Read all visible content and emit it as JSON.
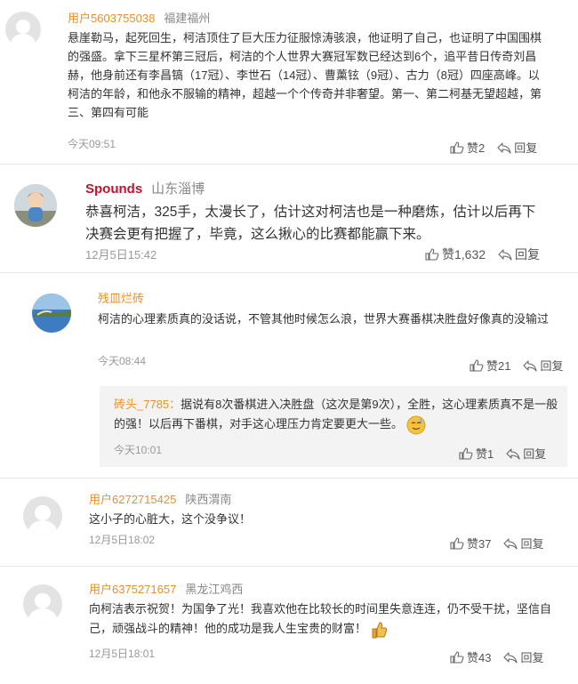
{
  "comments": [
    {
      "user": "用户5603755038",
      "location": "福建福州",
      "text": "悬崖勒马，起死回生，柯洁顶住了巨大压力征服惊涛骇浪，他证明了自己，也证明了中国围棋的强盛。拿下三星杯第三冠后，柯洁的个人世界大赛冠军数已经达到6个，追平昔日传奇刘昌赫，他身前还有李昌镐（17冠）、李世石（14冠）、曹薰铉（9冠）、古力（8冠）四座高峰。以柯洁的年龄，和他永不服输的精神，超越一个个传奇并非奢望。第一、第二柯基无望超越，第三、第四有可能",
      "time": "今天09:51",
      "likes": "赞2",
      "reply": "回复"
    },
    {
      "user": "Spounds",
      "location": "山东淄博",
      "text": "恭喜柯洁，325手，太漫长了，估计这对柯洁也是一种磨炼，估计以后再下决赛会更有把握了，毕竟，这么揪心的比赛都能赢下来。",
      "time": "12月5日15:42",
      "likes": "赞1,632",
      "reply": "回复"
    },
    {
      "user": "残皿烂砖",
      "location": "",
      "text": "柯洁的心理素质真的没话说，不管其他时候怎么浪，世界大赛番棋决胜盘好像真的没输过",
      "time": "今天08:44",
      "likes": "赞21",
      "reply": "回复",
      "sub_reply": {
        "user": "砖头_7785：",
        "text": "据说有8次番棋进入决胜盘（这次是第9次），全胜，这心理素质真不是一般的强！以后再下番棋，对手这心理压力肯定要更大一些。",
        "time": "今天10:01",
        "likes": "赞1",
        "reply": "回复"
      }
    },
    {
      "user": "用户6272715425",
      "location": "陕西渭南",
      "text": "这小子的心脏大，这个没争议！",
      "time": "12月5日18:02",
      "likes": "赞37",
      "reply": "回复"
    },
    {
      "user": "用户6375271657",
      "location": "黑龙江鸡西",
      "text": "向柯洁表示祝贺！为国争了光！我喜欢他在比较长的时间里失意连连，仍不受干扰，坚信自己，顽强战斗的精神！他的成功是我人生宝贵的财富！",
      "time": "12月5日18:01",
      "likes": "赞43",
      "reply": "回复"
    }
  ],
  "colors": {
    "username": "#e8912b",
    "spounds": "#c8102e",
    "meta": "#999999"
  },
  "icons": [
    "thumbs-up-icon",
    "reply-arrow-icon",
    "sweat-smile-emoji-icon",
    "thumbs-up-emoji-icon"
  ]
}
